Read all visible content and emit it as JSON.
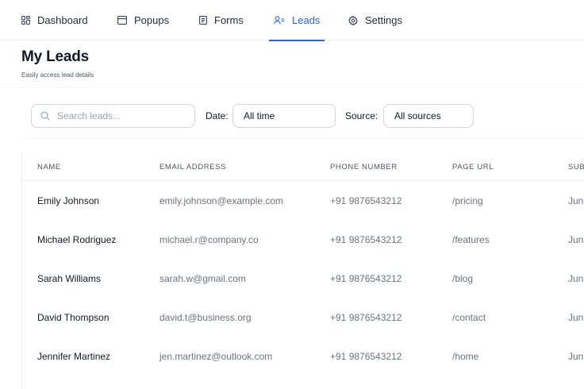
{
  "nav": {
    "items": [
      {
        "label": "Dashboard",
        "icon": "grid-icon"
      },
      {
        "label": "Popups",
        "icon": "window-icon"
      },
      {
        "label": "Forms",
        "icon": "document-icon"
      },
      {
        "label": "Leads",
        "icon": "users-icon",
        "active": true
      },
      {
        "label": "Settings",
        "icon": "gear-icon"
      }
    ]
  },
  "header": {
    "title": "My Leads",
    "subtitle": "Easily access lead details"
  },
  "filters": {
    "search_placeholder": "Search leads...",
    "date_label": "Date:",
    "date_value": "All time",
    "source_label": "Source:",
    "source_value": "All sources"
  },
  "table": {
    "columns": [
      "NAME",
      "EMAIL ADDRESS",
      "PHONE NUMBER",
      "PAGE URL",
      "SUB"
    ],
    "rows": [
      {
        "name": "Emily Johnson",
        "email": "emily.johnson@example.com",
        "phone": "+91 9876543212",
        "url": "/pricing",
        "sub": "Jun"
      },
      {
        "name": "Michael Rodriguez",
        "email": "michael.r@company.co",
        "phone": "+91 9876543212",
        "url": "/features",
        "sub": "Jun"
      },
      {
        "name": "Sarah Williams",
        "email": "sarah.w@gmail.com",
        "phone": "+91 9876543212",
        "url": "/blog",
        "sub": "Jun"
      },
      {
        "name": "David Thompson",
        "email": "david.t@business.org",
        "phone": "+91 9876543212",
        "url": "/contact",
        "sub": "Jun"
      },
      {
        "name": "Jennifer Martinez",
        "email": "jen.martinez@outlook.com",
        "phone": "+91 9876543212",
        "url": "/home",
        "sub": "Jun"
      }
    ]
  },
  "colors": {
    "accent": "#2563eb",
    "text": "#111827",
    "muted": "#6b7280",
    "border": "#e5e7eb"
  }
}
